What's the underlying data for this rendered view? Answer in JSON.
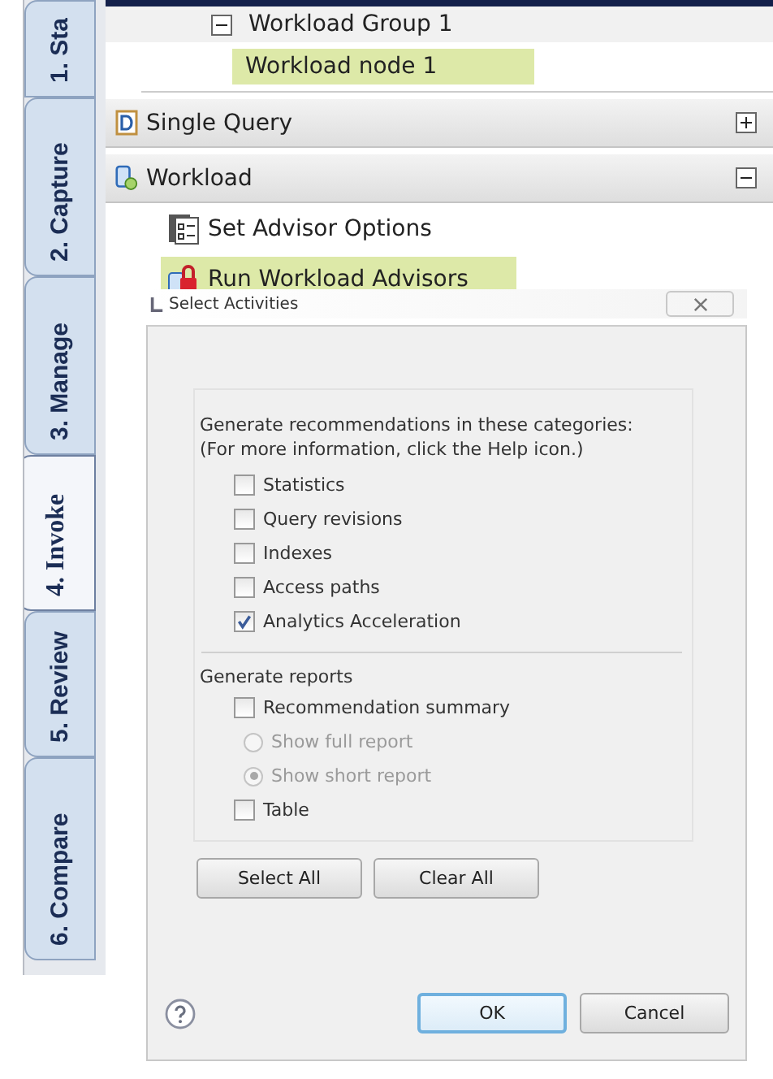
{
  "tabs": [
    {
      "label": "1. Sta",
      "selected": false
    },
    {
      "label": "2. Capture",
      "selected": false
    },
    {
      "label": "3. Manage",
      "selected": false
    },
    {
      "label": "4. Invoke",
      "selected": true
    },
    {
      "label": "5. Review",
      "selected": false
    },
    {
      "label": "6. Compare",
      "selected": false
    }
  ],
  "tree": {
    "group": {
      "label": "Workload Group 1",
      "expanded": true
    },
    "node": {
      "label": "Workload node 1",
      "selected": true
    }
  },
  "sections": [
    {
      "title": "Single Query",
      "kind": "query",
      "expanded": false
    },
    {
      "title": "Workload",
      "kind": "workload",
      "expanded": true,
      "items": [
        {
          "label": "Set Advisor Options",
          "kind": "options",
          "selected": false
        },
        {
          "label": "Run Workload Advisors",
          "kind": "run",
          "selected": true
        }
      ]
    }
  ],
  "dialog": {
    "title": "Select Activities",
    "intro": [
      "Generate recommendations in these categories:",
      "(For more information, click the Help icon.)"
    ],
    "categories": [
      {
        "label": "Statistics",
        "checked": false
      },
      {
        "label": "Query revisions",
        "checked": false
      },
      {
        "label": "Indexes",
        "checked": false
      },
      {
        "label": "Access paths",
        "checked": false
      },
      {
        "label": "Analytics Acceleration",
        "checked": true
      }
    ],
    "reports_heading": "Generate reports",
    "reports": [
      {
        "kind": "checkbox",
        "label": "Recommendation summary",
        "checked": false
      },
      {
        "kind": "radio",
        "label": "Show full report",
        "selected": false,
        "disabled": true
      },
      {
        "kind": "radio",
        "label": "Show short report",
        "selected": true,
        "disabled": true
      },
      {
        "kind": "checkbox",
        "label": "Table",
        "checked": false
      }
    ],
    "group_buttons": [
      "Select All",
      "Clear All"
    ],
    "buttons": [
      {
        "label": "OK",
        "default": true
      },
      {
        "label": "Cancel",
        "default": false
      }
    ]
  }
}
